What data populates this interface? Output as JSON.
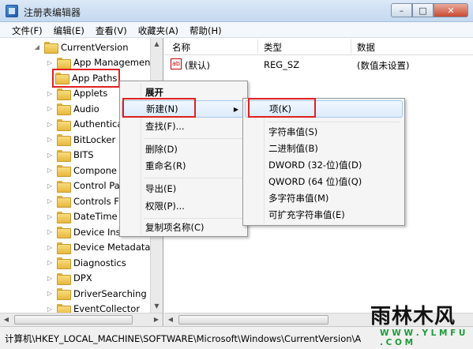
{
  "window": {
    "title": "注册表编辑器"
  },
  "window_buttons": {
    "min": "–",
    "max": "□",
    "close": "✕"
  },
  "menubar": [
    "文件(F)",
    "编辑(E)",
    "查看(V)",
    "收藏夹(A)",
    "帮助(H)"
  ],
  "tree": {
    "root": "CurrentVersion",
    "items": [
      "App Managemen",
      "App Paths",
      "Applets",
      "Audio",
      "Authentica",
      "BitLocker",
      "BITS",
      "Compone",
      "Control Pa",
      "Controls F",
      "DateTime",
      "Device Ins",
      "Device Metadata",
      "Diagnostics",
      "DPX",
      "DriverSearching",
      "EventCollector"
    ]
  },
  "columns": {
    "name": "名称",
    "type": "类型",
    "data": "数据"
  },
  "value_row": {
    "icon_text": "ab",
    "name": "(默认)",
    "type": "REG_SZ",
    "data": "(数值未设置)"
  },
  "context_menu": {
    "items": [
      "展开",
      "新建(N)",
      "查找(F)...",
      "删除(D)",
      "重命名(R)",
      "导出(E)",
      "权限(P)...",
      "复制项名称(C)"
    ]
  },
  "submenu": {
    "items": [
      "项(K)",
      "字符串值(S)",
      "二进制值(B)",
      "DWORD (32-位)值(D)",
      "QWORD (64 位)值(Q)",
      "多字符串值(M)",
      "可扩充字符串值(E)"
    ]
  },
  "statusbar": {
    "path": "计算机\\HKEY_LOCAL_MACHINE\\SOFTWARE\\Microsoft\\Windows\\CurrentVersion\\A"
  },
  "watermark": {
    "title": "雨林木风",
    "url": "W W W . Y L M F U . C O M"
  },
  "colors": {
    "highlight_border": "#e02020",
    "menu_bg": "#f5f5f5",
    "titlebar": "#c4d8ef",
    "watermark_url": "#1d9b3a"
  }
}
